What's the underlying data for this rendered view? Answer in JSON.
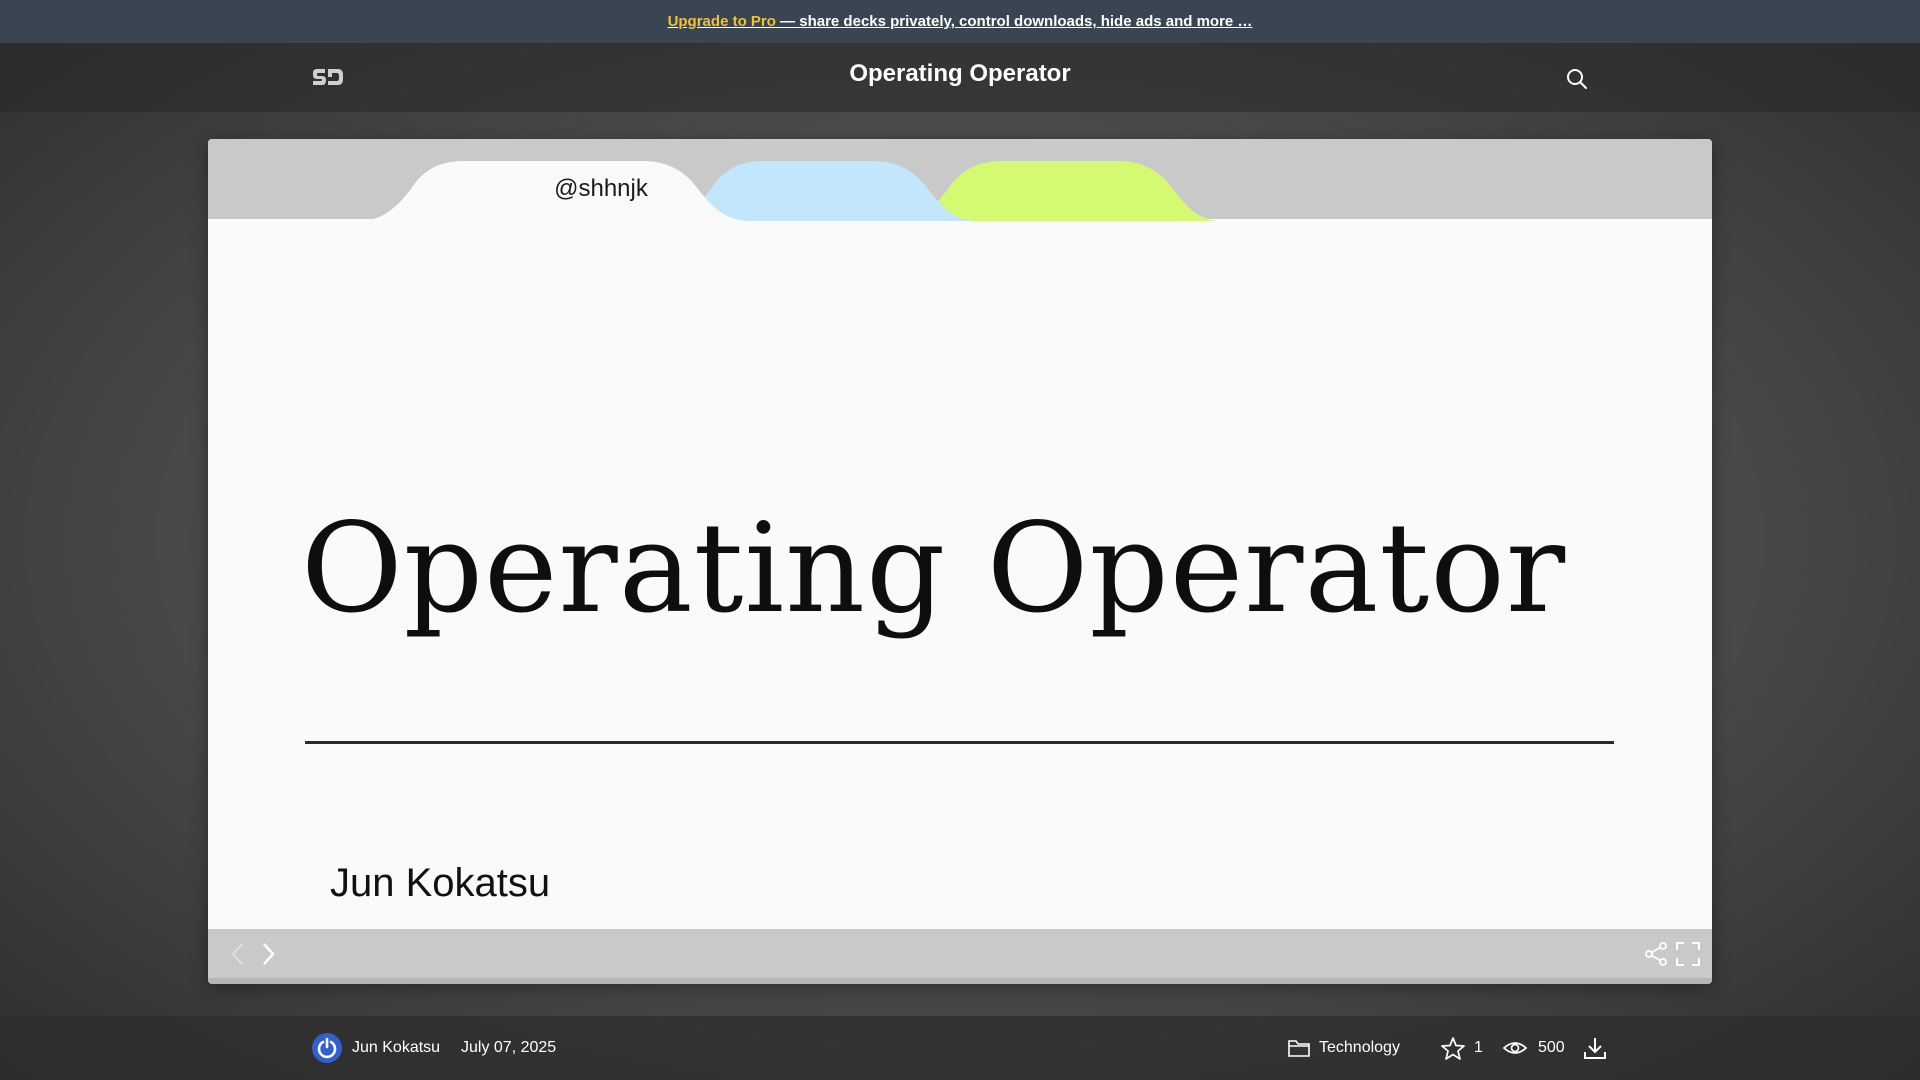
{
  "promo": {
    "link_label": "Upgrade to Pro",
    "text": " — share decks privately, control downloads, hide ads and more …"
  },
  "header": {
    "logo_text": "SD",
    "title": "Operating Operator",
    "search_icon": "search-icon"
  },
  "slide": {
    "handle": "@shhnjk",
    "title": "Operating Operator",
    "author": "Jun Kokatsu",
    "tab_colors": [
      "#fafafa",
      "#c2e7fc",
      "#d4fa72"
    ]
  },
  "controls": {
    "prev_icon": "chevron-left-icon",
    "next_icon": "chevron-right-icon",
    "share_icon": "share-icon",
    "fullscreen_icon": "fullscreen-icon"
  },
  "footer": {
    "author_name": "Jun Kokatsu",
    "date": "July 07, 2025",
    "category": "Technology",
    "stars": "1",
    "views": "500",
    "download_icon": "download-icon"
  },
  "colors": {
    "promo_bg": "#394550",
    "pro_accent": "#f1c232",
    "avatar_bg": "#2f5fd0"
  }
}
